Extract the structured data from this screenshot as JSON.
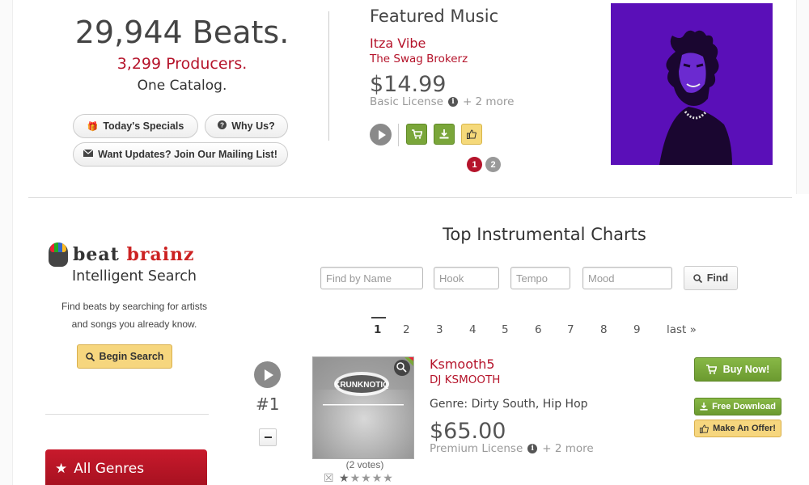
{
  "stats": {
    "beats": "29,944 Beats.",
    "producers": "3,299 Producers.",
    "catalog": "One Catalog."
  },
  "promo_buttons": {
    "specials": "Today's Specials",
    "why": "Why Us?",
    "mailing": "Want Updates? Join Our Mailing List!"
  },
  "featured": {
    "heading": "Featured Music",
    "track": "Itza Vibe",
    "producer": "The Swag Brokerz",
    "price": "$14.99",
    "license": "Basic License",
    "more": "+ 2 more",
    "pages": [
      "1",
      "2"
    ],
    "active_page": "1"
  },
  "brand": {
    "logo_word1": "beat",
    "logo_word2": "brainz",
    "tagline": "Intelligent Search",
    "description_line1": "Find beats by searching for artists",
    "description_line2": "and songs you already know.",
    "begin_button": "Begin Search"
  },
  "sidebar": {
    "genres_label": "All Genres"
  },
  "charts": {
    "title": "Top Instrumental Charts",
    "search": {
      "name_placeholder": "Find by Name",
      "hook_placeholder": "Hook",
      "tempo_placeholder": "Tempo",
      "mood_placeholder": "Mood",
      "find_button": "Find"
    },
    "pagination": [
      "1",
      "2",
      "3",
      "4",
      "5",
      "6",
      "7",
      "8",
      "9",
      "last »"
    ],
    "active_page": "1",
    "rows": [
      {
        "rank": "#1",
        "name": "Ksmooth5",
        "producer": "DJ KSMOOTH",
        "genre": "Genre: Dirty South, Hip Hop",
        "price": "$65.00",
        "license": "Premium License",
        "more": "+ 2 more",
        "cover_text": "KRUNKNOTIQ",
        "votes": "(2 votes)",
        "rating": 1,
        "rating_max": 5,
        "buy_button": "Buy Now!",
        "free_button": "Free Download",
        "offer_button": "Make An Offer!"
      }
    ]
  },
  "colors": {
    "accent_red": "#b5142b",
    "green": "#7aa63a",
    "yellow": "#f6d67e",
    "art_purple": "#5a0fb8"
  }
}
